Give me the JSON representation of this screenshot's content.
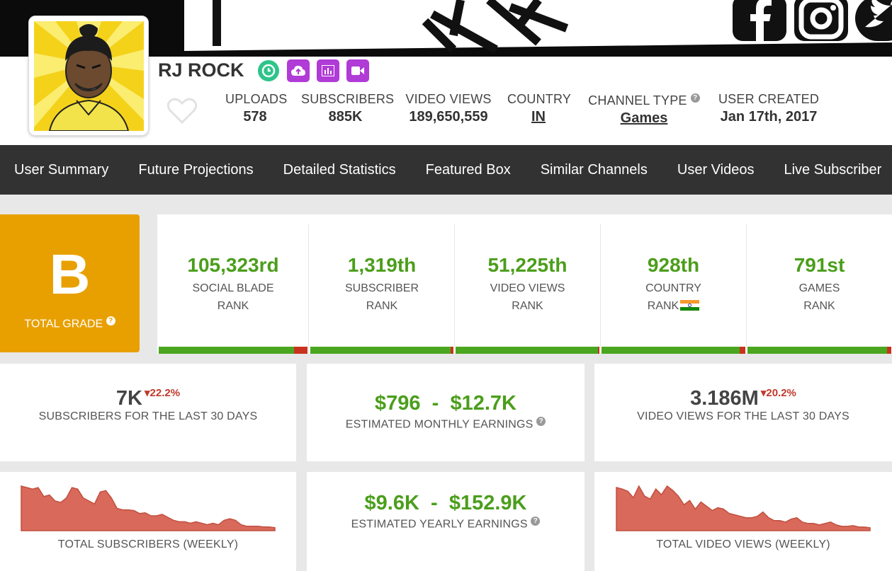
{
  "channel": {
    "name": "RJ ROCK",
    "stats": [
      {
        "label": "UPLOADS",
        "value": "578"
      },
      {
        "label": "SUBSCRIBERS",
        "value": "885K"
      },
      {
        "label": "VIDEO VIEWS",
        "value": "189,650,559"
      },
      {
        "label": "COUNTRY",
        "value": "IN"
      },
      {
        "label": "CHANNEL TYPE",
        "value": "Games"
      },
      {
        "label": "USER CREATED",
        "value": "Jan 17th, 2017"
      }
    ]
  },
  "nav": {
    "items": [
      "User Summary",
      "Future Projections",
      "Detailed Statistics",
      "Featured Box",
      "Similar Channels",
      "User Videos",
      "Live Subscriber"
    ]
  },
  "grade": {
    "letter": "B",
    "label": "TOTAL GRADE"
  },
  "ranks": [
    {
      "value": "105,323rd",
      "line1": "SOCIAL BLADE",
      "line2": "RANK",
      "down_fraction": 0.09
    },
    {
      "value": "1,319th",
      "line1": "SUBSCRIBER",
      "line2": "RANK",
      "down_fraction": 0.02
    },
    {
      "value": "51,225th",
      "line1": "VIDEO VIEWS",
      "line2": "RANK",
      "down_fraction": 0.01
    },
    {
      "value": "928th",
      "line1": "COUNTRY",
      "line2": "RANK",
      "down_fraction": 0.04
    },
    {
      "value": "791st",
      "line1": "GAMES",
      "line2": "RANK",
      "down_fraction": 0.03
    }
  ],
  "summary": {
    "subs30": {
      "value": "7K",
      "change": "22.2%",
      "label": "SUBSCRIBERS FOR THE LAST 30 DAYS"
    },
    "monthly": {
      "low": "$796",
      "sep": "-",
      "high": "$12.7K",
      "label": "ESTIMATED MONTHLY EARNINGS"
    },
    "views30": {
      "value": "3.186M",
      "change": "20.2%",
      "label": "VIDEO VIEWS FOR THE LAST 30 DAYS"
    },
    "yearly": {
      "low": "$9.6K",
      "sep": "-",
      "high": "$152.9K",
      "label": "ESTIMATED YEARLY EARNINGS"
    }
  },
  "sparklines": {
    "subs": {
      "label": "TOTAL SUBSCRIBERS (WEEKLY)",
      "values": [
        60,
        58,
        56,
        58,
        46,
        48,
        40,
        38,
        44,
        58,
        56,
        44,
        40,
        36,
        52,
        54,
        44,
        30,
        28,
        28,
        27,
        23,
        24,
        20,
        20,
        22,
        18,
        14,
        12,
        12,
        10,
        12,
        10,
        8,
        10,
        8,
        14,
        16,
        14,
        8,
        6,
        6,
        6,
        5,
        5,
        4
      ]
    },
    "views": {
      "label": "TOTAL VIDEO VIEWS (WEEKLY)",
      "values": [
        60,
        58,
        55,
        46,
        62,
        48,
        44,
        58,
        50,
        62,
        56,
        48,
        36,
        42,
        30,
        40,
        34,
        28,
        32,
        30,
        24,
        22,
        20,
        18,
        18,
        20,
        26,
        18,
        14,
        14,
        12,
        16,
        18,
        12,
        10,
        10,
        8,
        10,
        12,
        8,
        6,
        6,
        7,
        5,
        5,
        4
      ]
    },
    "color": "#d9695a"
  }
}
